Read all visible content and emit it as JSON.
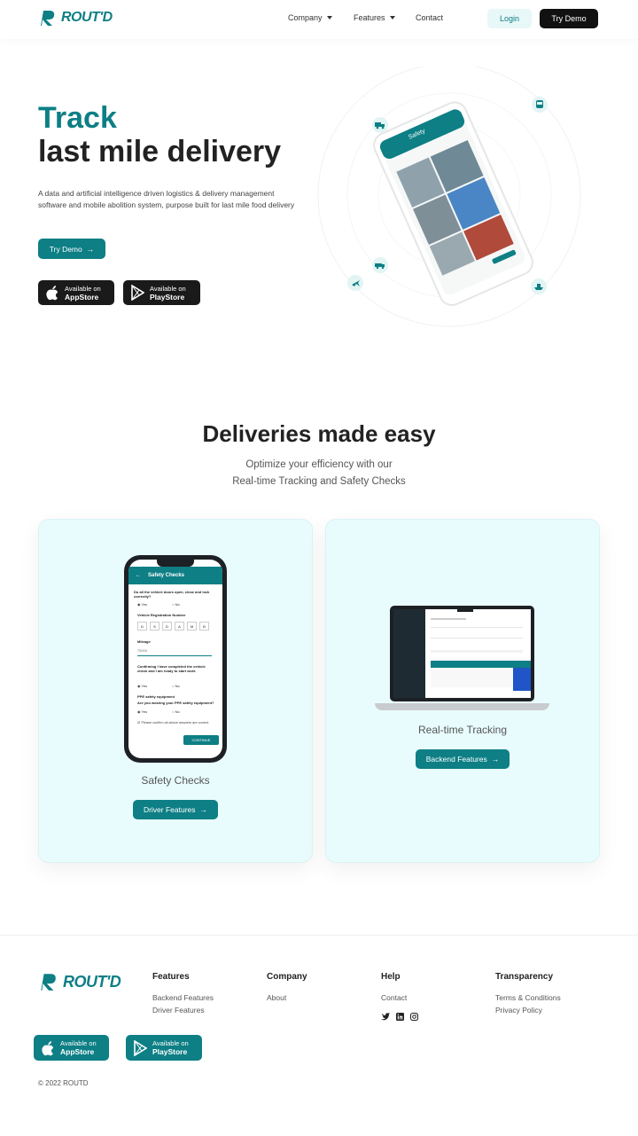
{
  "header": {
    "logo_text": "ROUT'D",
    "nav": [
      {
        "label": "Company",
        "has_dropdown": true
      },
      {
        "label": "Features",
        "has_dropdown": true
      },
      {
        "label": "Contact",
        "has_dropdown": false
      }
    ],
    "login_label": "Login",
    "demo_label": "Try Demo"
  },
  "hero": {
    "title_line1": "Track",
    "title_line2": "last mile delivery",
    "description": "A data and artificial intelligence driven logistics & delivery management software and mobile abolition system, purpose built for last mile food delivery",
    "cta_label": "Try Demo",
    "appstore": {
      "line1": "Available on",
      "line2": "AppStore"
    },
    "playstore": {
      "line1": "Available on",
      "line2": "PlayStore"
    },
    "phone": {
      "screen_title": "Safety"
    },
    "floating_icons": [
      "truck-icon",
      "bus-icon",
      "van-icon",
      "plane-icon",
      "ship-icon"
    ]
  },
  "deliveries": {
    "title": "Deliveries made easy",
    "subtitle_line1": "Optimize your efficiency with our",
    "subtitle_line2": "Real-time Tracking and Safety Checks",
    "cards": [
      {
        "label": "Safety Checks",
        "button": "Driver Features"
      },
      {
        "label": "Real-time Tracking",
        "button": "Backend Features"
      }
    ],
    "safety_screen": {
      "header": "Safety Checks",
      "q1": "Do all the vehicle doors open, close and lock correctly?",
      "yes": "Yes",
      "no": "No",
      "reg_label": "Vehicle Registration Number",
      "reg_chars": [
        "D",
        "S",
        "D",
        "A",
        "M",
        "B"
      ],
      "mileage_label": "Mileage",
      "mileage_value": "75000",
      "confirm_text": "Confirming I have completed the vehicle check and I am ready to start work",
      "ppe_label": "PPE safety equipment",
      "ppe_question": "Are you wearing your PPE safety equipment?",
      "agree_text": "Please confirm all above answers are correct.",
      "continue": "CONTINUE"
    }
  },
  "footer": {
    "logo_text": "ROUT'D",
    "columns": [
      {
        "heading": "Features",
        "links": [
          "Backend Features",
          "Driver Features"
        ]
      },
      {
        "heading": "Company",
        "links": [
          "About"
        ]
      },
      {
        "heading": "Help",
        "links": [
          "Contact"
        ]
      },
      {
        "heading": "Transparency",
        "links": [
          "Terms & Conditions",
          "Privacy Policy"
        ]
      }
    ],
    "social": [
      "twitter-icon",
      "linkedin-icon",
      "instagram-icon"
    ],
    "appstore": {
      "line1": "Available on",
      "line2": "AppStore"
    },
    "playstore": {
      "line1": "Available on",
      "line2": "PlayStore"
    },
    "copyright": "© 2022 ROUTD"
  },
  "colors": {
    "brand": "#0d7f85",
    "dark": "#111111",
    "card_bg": "#e8fcfd"
  }
}
